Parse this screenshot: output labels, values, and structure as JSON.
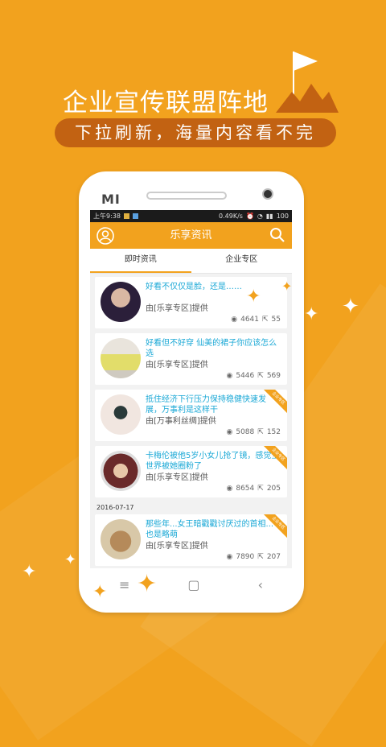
{
  "promo": {
    "headline": "企业宣传联盟阵地",
    "subline": "下拉刷新，海量内容看不完"
  },
  "device": {
    "brand": "MI"
  },
  "status_bar": {
    "time": "上午9:38",
    "speed": "0.49K/s",
    "battery": "100"
  },
  "app": {
    "title": "乐享资讯",
    "tabs": [
      {
        "label": "即时资讯",
        "active": true
      },
      {
        "label": "企业专区",
        "active": false
      }
    ]
  },
  "articles": [
    {
      "title": "好看不仅仅是脸，还是……",
      "source": "由[乐享专区]提供",
      "views": "4641",
      "shares": "55",
      "badge": ""
    },
    {
      "title": "好看但不好穿 仙美的裙子你应该怎么选",
      "source": "由[乐享专区]提供",
      "views": "5446",
      "shares": "569",
      "badge": ""
    },
    {
      "title": "抵住经济下行压力保持稳健快速发展，万事利是这样干",
      "source": "由[万事利丝绸]提供",
      "views": "5088",
      "shares": "152",
      "badge": "企业专区"
    },
    {
      "title": "卡梅伦被他5岁小女儿抢了镜，感觉全世界被她圈粉了",
      "source": "由[乐享专区]提供",
      "views": "8654",
      "shares": "205",
      "badge": "企业专区"
    },
    {
      "title": "那些年...女王暗戳戳讨厌过的首相...也是略萌",
      "source": "由[乐享专区]提供",
      "views": "7890",
      "shares": "207",
      "badge": "企业专区"
    }
  ],
  "date_separator": "2016-07-17",
  "colors": {
    "accent": "#F2A21E",
    "title_blue": "#1AA8D6",
    "pill": "#C26212"
  },
  "icons": {
    "nav": [
      "menu-icon",
      "home-icon",
      "back-icon"
    ]
  }
}
